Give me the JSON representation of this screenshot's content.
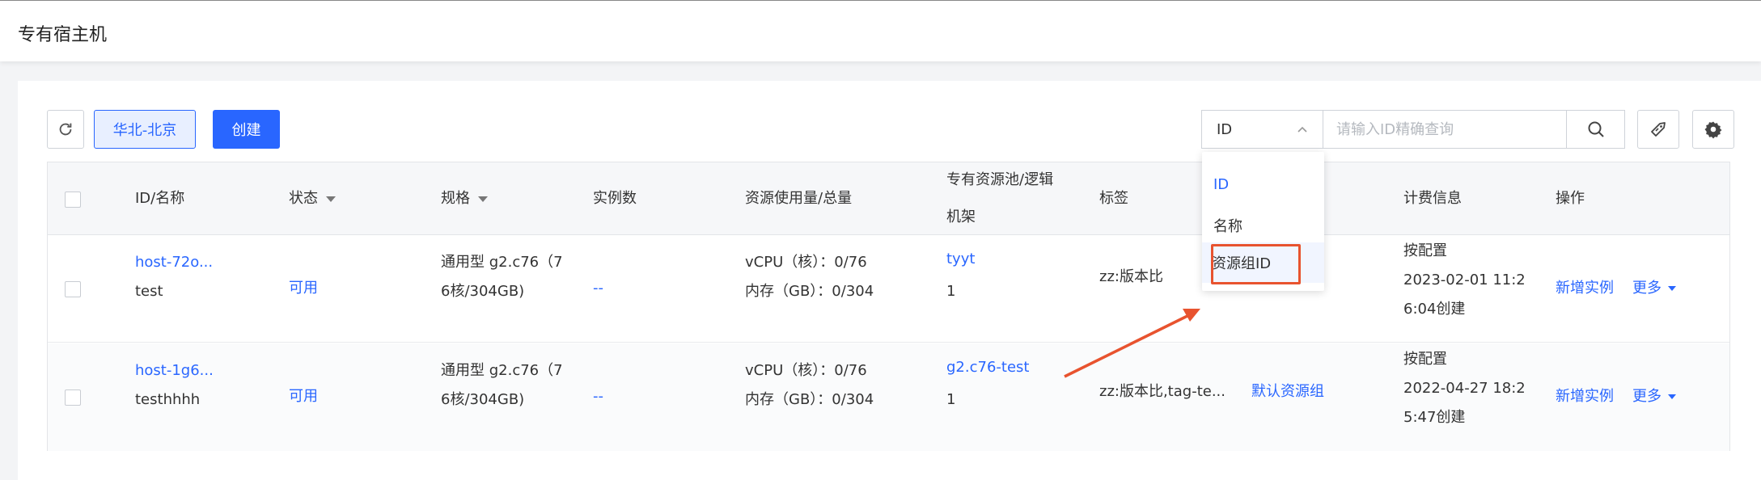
{
  "header": {
    "title": "专有宿主机"
  },
  "toolbar": {
    "region_label": "华北-北京",
    "create_label": "创建"
  },
  "search": {
    "field_selected": "ID",
    "placeholder": "请输入ID精确查询"
  },
  "table": {
    "columns": {
      "id_name": "ID/名称",
      "status": "状态",
      "spec": "规格",
      "instances": "实例数",
      "usage": "资源使用量/总量",
      "pool_line1": "专有资源池/逻辑",
      "pool_line2": "机架",
      "tags": "标签",
      "billing": "计费信息",
      "actions": "操作"
    },
    "rows": [
      {
        "id": "host-72o...",
        "name": "test",
        "status": "可用",
        "spec_line1": "通用型 g2.c76（7",
        "spec_line2": "6核/304GB)",
        "instances": "--",
        "vcpu": "vCPU（核）：0/76",
        "memory": "内存（GB）：0/304",
        "pool": "tyyt",
        "rack": "1",
        "tags": "zz:版本比",
        "resource_group": "",
        "billing_mode": "按配置",
        "created_line1": "2023-02-01 11:2",
        "created_line2": "6:04创建",
        "action_new": "新增实例",
        "action_more": "更多"
      },
      {
        "id": "host-1g6...",
        "name": "testhhhh",
        "status": "可用",
        "spec_line1": "通用型 g2.c76（7",
        "spec_line2": "6核/304GB)",
        "instances": "--",
        "vcpu": "vCPU（核）：0/76",
        "memory": "内存（GB）：0/304",
        "pool": "g2.c76-test",
        "rack": "1",
        "tags": "zz:版本比,tag-te...",
        "resource_group": "默认资源组",
        "billing_mode": "按配置",
        "created_line1": "2022-04-27 18:2",
        "created_line2": "5:47创建",
        "action_new": "新增实例",
        "action_more": "更多"
      }
    ]
  },
  "search_dropdown": {
    "options": [
      "ID",
      "名称",
      "资源组ID"
    ],
    "selected": "ID"
  },
  "colors": {
    "primary": "#2966ff",
    "annotation": "#e8532f"
  }
}
